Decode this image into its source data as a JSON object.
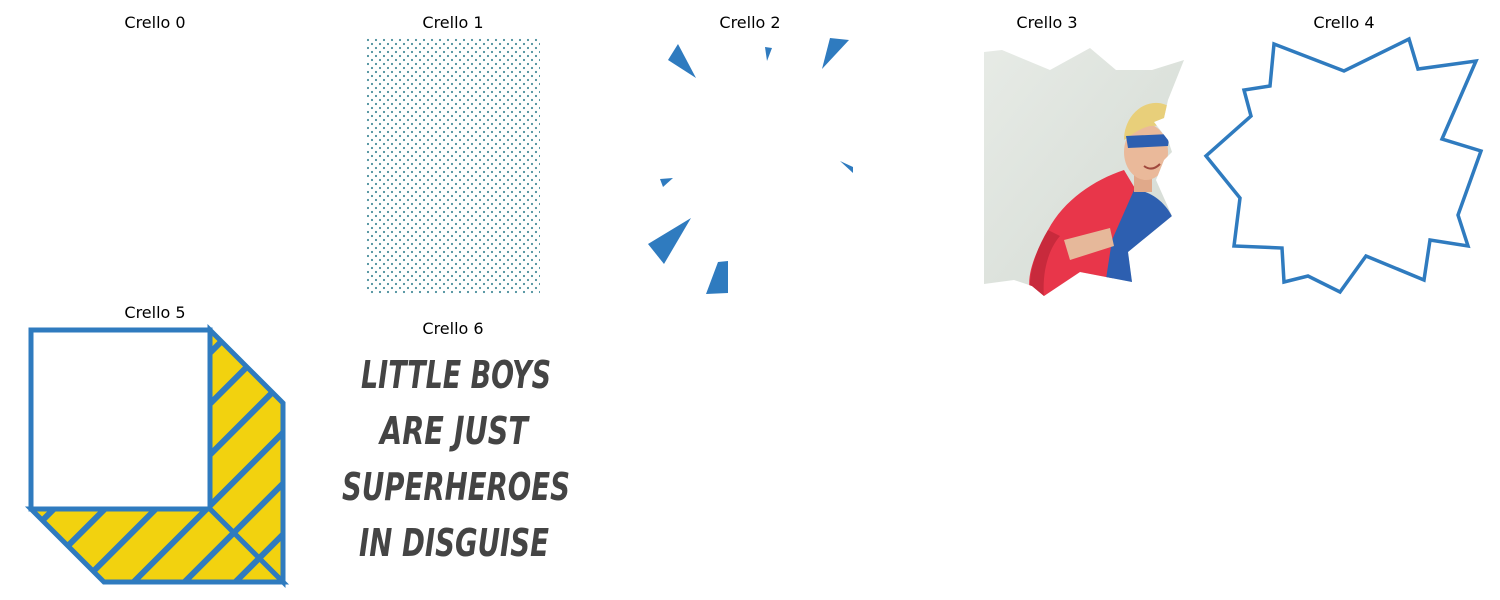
{
  "panels": [
    {
      "title": "Crello 0"
    },
    {
      "title": "Crello 1"
    },
    {
      "title": "Crello 2"
    },
    {
      "title": "Crello 3"
    },
    {
      "title": "Crello 4"
    },
    {
      "title": "Crello 5"
    },
    {
      "title": "Crello 6"
    }
  ],
  "quote": {
    "line1": "LITTLE BOYS",
    "line2": "ARE JUST",
    "line3": "SUPERHEROES",
    "line4": "IN DISGUISE"
  },
  "colors": {
    "accent_blue": "#2f7bbf",
    "stripe_yellow": "#f2d20f",
    "quote_text": "#444444",
    "dot_teal": "#4a8f9c",
    "cape_red": "#e8364a",
    "shirt_blue": "#2d5fb0",
    "sky": "#dfe4df"
  },
  "icons": {
    "panel3": "superhero-boy-photo",
    "panel4": "starburst-outline-icon",
    "panel5": "striped-cube-icon"
  }
}
